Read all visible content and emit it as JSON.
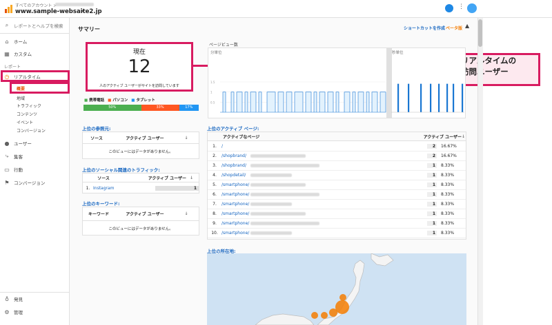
{
  "header": {
    "account_label": "すべてのアカウント >",
    "site": "www.sample-websaite2.jp"
  },
  "sidebar": {
    "search_placeholder": "レポートとヘルプを検索",
    "items": {
      "home": "ホーム",
      "custom": "カスタム",
      "reports_heading": "レポート",
      "realtime": "リアルタイム",
      "overview": "概要",
      "location": "地域",
      "traffic": "トラフィック",
      "content": "コンテンツ",
      "events": "イベント",
      "conversions_sub": "コンバージョン",
      "users": "ユーザー",
      "acquisition": "集客",
      "behavior": "行動",
      "conversions": "コンバージョン",
      "discover": "発見",
      "admin": "管理"
    }
  },
  "main": {
    "title": "サマリー",
    "shortcut": "ショートカットを作成",
    "beta": "ベータ版",
    "now_label": "現在",
    "active_count": "12",
    "active_caption": "人のアクティブ ユーザーがサイトを訪問しています",
    "device_legend": {
      "mobile": "携帯電話",
      "pc": "パソコン",
      "tablet": "タブレット"
    },
    "device_split": {
      "mobile": 50,
      "pc": 33,
      "tablet": 17
    },
    "device_labels": {
      "mobile": "50%",
      "pc": "33%",
      "tablet": "17%"
    },
    "pageview_title": "ページビュー数",
    "per_minute": "分単位",
    "per_second": "秒単位",
    "y_ticks": [
      "1.5",
      "1",
      "0.5"
    ],
    "referrers": {
      "title": "上位の参照元:",
      "col_source": "ソース",
      "col_active": "アクティブ ユーザー",
      "empty": "このビューにはデータがありません。"
    },
    "social": {
      "title": "上位のソーシャル関連のトラフィック:",
      "col_source": "ソース",
      "col_active": "アクティブ ユーザー",
      "rows": [
        {
          "n": "1.",
          "source": "Instagram",
          "count": "1"
        }
      ]
    },
    "keywords": {
      "title": "上位のキーワード:",
      "col_keyword": "キーワード",
      "col_active": "アクティブ ユーザー",
      "empty": "このビューにはデータがありません。"
    },
    "pages": {
      "title": "上位のアクティブ ページ:",
      "col_page": "アクティブなページ",
      "col_active": "アクティブ ユーザー",
      "rows": [
        {
          "n": "1.",
          "page": "/",
          "count": "2",
          "pct": "16.67%"
        },
        {
          "n": "2.",
          "page": "/shopbrand/",
          "count": "2",
          "pct": "16.67%"
        },
        {
          "n": "3.",
          "page": "/shopbrand/",
          "count": "1",
          "pct": "8.33%"
        },
        {
          "n": "4.",
          "page": "/shopdetail/",
          "count": "1",
          "pct": "8.33%"
        },
        {
          "n": "5.",
          "page": "/smartphone/",
          "count": "1",
          "pct": "8.33%"
        },
        {
          "n": "6.",
          "page": "/smartphone/",
          "count": "1",
          "pct": "8.33%"
        },
        {
          "n": "7.",
          "page": "/smartphone/",
          "count": "1",
          "pct": "8.33%"
        },
        {
          "n": "8.",
          "page": "/smartphone/",
          "count": "1",
          "pct": "8.33%"
        },
        {
          "n": "9.",
          "page": "/smartphone/",
          "count": "1",
          "pct": "8.33%"
        },
        {
          "n": "10.",
          "page": "/smartphone/",
          "count": "1",
          "pct": "8.33%"
        }
      ]
    },
    "locations_title": "上位の所在地:"
  },
  "callout": {
    "line1": "リアルタイムの",
    "line2": "訪問ユーザー"
  },
  "colors": {
    "accent_pink": "#d81b60",
    "mobile": "#4caf50",
    "pc": "#ff5722",
    "tablet": "#2196f3",
    "bar_blue": "#1976d2",
    "map_dot": "#f57c00"
  },
  "chart_data": {
    "type": "bar",
    "per_minute": [
      0,
      1,
      0,
      0,
      1,
      0,
      1,
      1,
      0,
      1,
      0,
      1,
      1,
      0,
      1,
      0,
      0,
      1,
      1,
      1,
      0,
      1,
      1,
      0,
      1,
      1,
      0,
      1,
      1,
      1,
      0,
      1,
      1,
      0,
      1,
      0,
      1,
      1,
      0,
      1,
      1,
      0,
      1,
      0,
      0,
      1,
      1,
      0,
      1,
      0,
      1,
      1,
      0,
      1,
      0,
      1,
      1,
      0,
      1,
      1
    ],
    "per_second_spikes": [
      1,
      1,
      1,
      1,
      1,
      1,
      1,
      1
    ],
    "ylim": [
      0,
      1.5
    ]
  }
}
